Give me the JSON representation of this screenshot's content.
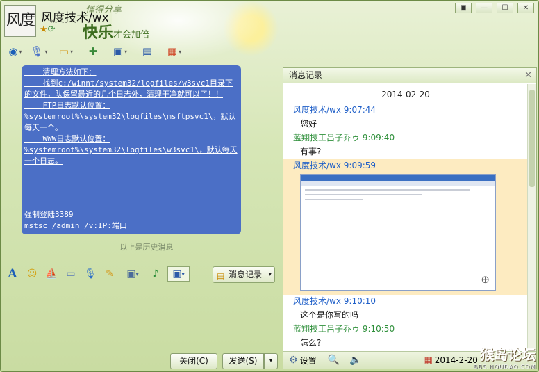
{
  "window": {
    "title": "风度技术/wx",
    "avatar_text": "风度",
    "slogan_top": "懂得分享",
    "slogan_main": "快乐",
    "slogan_sub": "才会加倍",
    "buttons": [
      "▣",
      "—",
      "☐",
      "✕"
    ]
  },
  "toolbar": {
    "icons": [
      "camera-icon",
      "microphone-icon",
      "file-transfer-icon",
      "add-contact-icon",
      "screen-share-icon",
      "remote-assist-icon",
      "apps-icon"
    ]
  },
  "chat": {
    "lines": [
      "    清理方法如下：",
      "    找到c:/winnt/system32/logfiles/w3svc1目录下的文件，队保留最近的几个日志外，清理干净就可以了！！",
      "    FTP日志默认位置：%systemroot%\\system32\\logfiles\\msftpsvc1\\，默认每天一个。",
      "    WWW日志默认位置：%systemroot%\\system32\\logfiles\\w3svc1\\，默认每天一个日志。"
    ],
    "link1": "强制登陆3389",
    "link2": "mstsc /admin /v:IP:端口",
    "history_sep": "以上是历史消息"
  },
  "input_bar": {
    "msg_record_label": "消息记录"
  },
  "buttons": {
    "close_label": "关闭(C)",
    "send_label": "发送(S)"
  },
  "record_panel": {
    "title": "消息记录",
    "date": "2014-02-20",
    "messages": [
      {
        "sender": "风度技术/wx 9:07:44",
        "text": "您好"
      },
      {
        "sender": "蓝翔技工吕子乔ゥ 9:09:40",
        "text": "有事?"
      },
      {
        "sender": "风度技术/wx 9:09:59",
        "text": ""
      },
      {
        "sender": "风度技术/wx 9:10:10",
        "text": "这个是你写的吗"
      },
      {
        "sender": "蓝翔技工吕子乔ゥ 9:10:50",
        "text": "怎么?"
      }
    ],
    "footer": {
      "settings_label": "设置",
      "date_label": "2014-2-20"
    }
  },
  "watermark": {
    "main": "猴岛论坛",
    "url": "BBS.HOUDAO.COM"
  },
  "colors": {
    "chat_bubble": "#4b6fc6",
    "sender_self": "#1f5fc8",
    "sender_other": "#2e8f3a",
    "highlight": "#fdebc1"
  }
}
